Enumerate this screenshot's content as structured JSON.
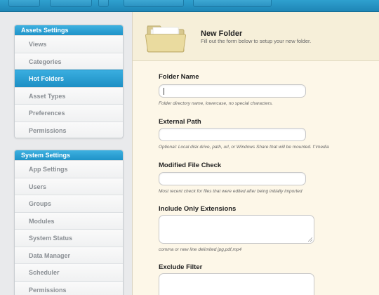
{
  "sidebar": {
    "assets": {
      "header": "Assets Settings",
      "items": [
        {
          "label": "Views"
        },
        {
          "label": "Categories"
        },
        {
          "label": "Hot Folders",
          "active": true
        },
        {
          "label": "Asset Types"
        },
        {
          "label": "Preferences"
        },
        {
          "label": "Permissions"
        }
      ]
    },
    "system": {
      "header": "System Settings",
      "items": [
        {
          "label": "App Settings"
        },
        {
          "label": "Users"
        },
        {
          "label": "Groups"
        },
        {
          "label": "Modules"
        },
        {
          "label": "System Status"
        },
        {
          "label": "Data Manager"
        },
        {
          "label": "Scheduler"
        },
        {
          "label": "Permissions"
        }
      ]
    }
  },
  "header": {
    "title": "New Folder",
    "subtitle": "Fill out the form below to setup your new folder."
  },
  "form": {
    "folder_name": {
      "label": "Folder Name",
      "value": "",
      "help": "Folder directory name, lowercase, no special characters."
    },
    "external_path": {
      "label": "External Path",
      "value": "",
      "help": "Optional: Local disk drive, path, url, or Windows Share that will be mounted. f:\\media"
    },
    "modified_file_check": {
      "label": "Modified File Check",
      "value": "",
      "help": "Most recent check for files that were edited after being initially imported"
    },
    "include_only_extensions": {
      "label": "Include Only Extensions",
      "value": "",
      "help": "comma or new line delimited jpg,pdf,mp4"
    },
    "exclude_filter": {
      "label": "Exclude Filter",
      "value": ""
    }
  },
  "icons": {
    "header_icon": "folder-icon"
  },
  "colors": {
    "accent": "#2a9ed3",
    "main_bg": "#fdf7e8"
  }
}
